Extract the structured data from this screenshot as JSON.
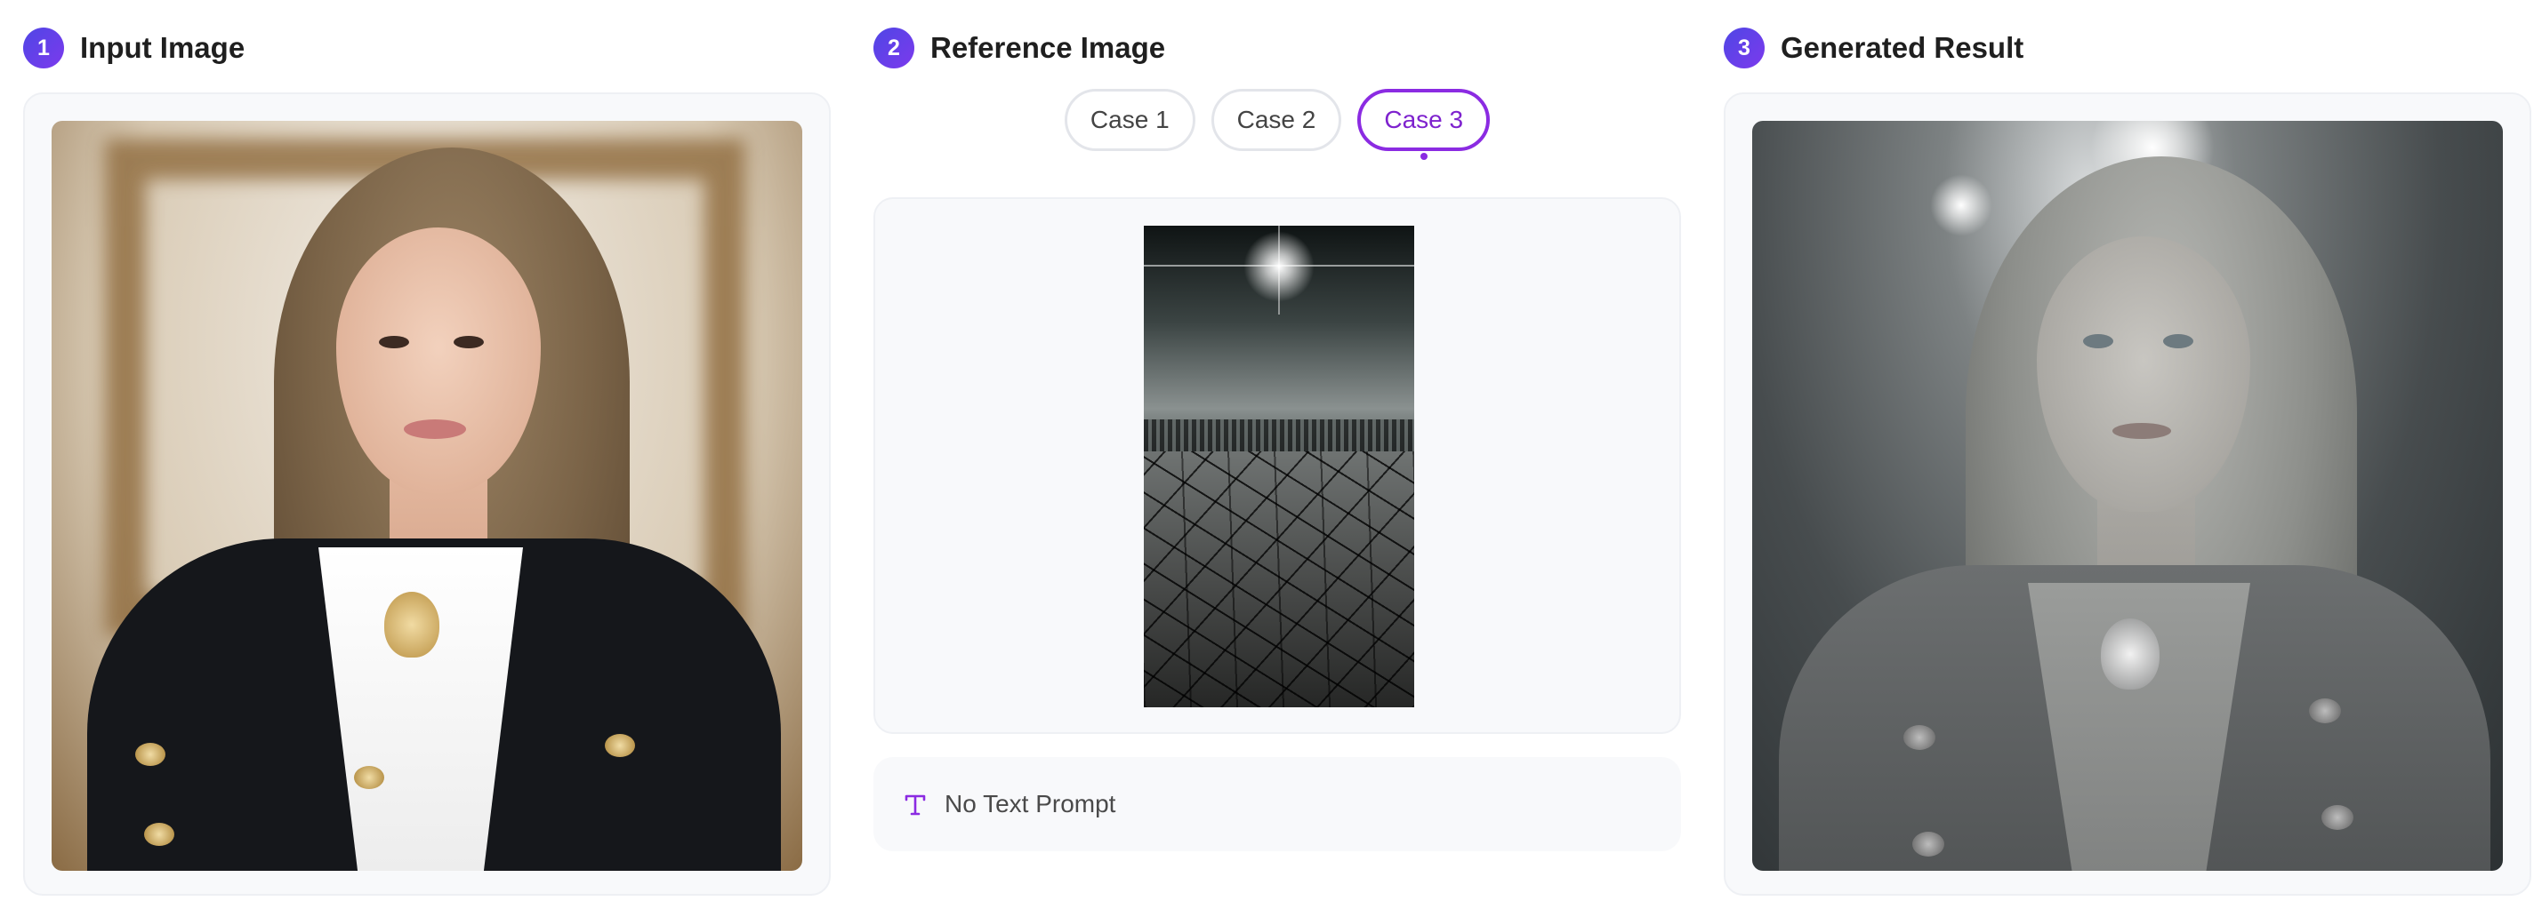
{
  "columns": [
    {
      "step": "1",
      "title": "Input Image"
    },
    {
      "step": "2",
      "title": "Reference Image"
    },
    {
      "step": "3",
      "title": "Generated Result"
    }
  ],
  "reference": {
    "tabs": [
      {
        "label": "Case 1",
        "active": false
      },
      {
        "label": "Case 2",
        "active": false
      },
      {
        "label": "Case 3",
        "active": true
      }
    ],
    "prompt_icon": "text-type-icon",
    "prompt_text": "No Text Prompt"
  },
  "colors": {
    "accent": "#8b2be2",
    "badge_gradient_start": "#4f46e5",
    "badge_gradient_end": "#7c3aed",
    "panel_bg": "#f8f9fb"
  }
}
